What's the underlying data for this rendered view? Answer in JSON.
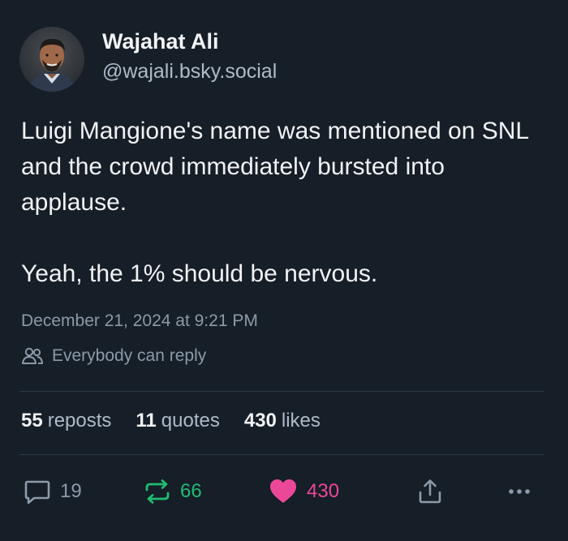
{
  "author": {
    "display_name": "Wajahat Ali",
    "handle": "@wajali.bsky.social",
    "avatar_icon": "avatar"
  },
  "post": {
    "paragraphs": [
      "Luigi Mangione's name was mentioned on SNL and the crowd immediately bursted into applause.",
      "Yeah, the 1% should be nervous."
    ],
    "timestamp": "December 21, 2024 at 9:21 PM",
    "reply_setting": "Everybody can reply"
  },
  "stats": {
    "reposts_count": "55",
    "reposts_label": "reposts",
    "quotes_count": "11",
    "quotes_label": "quotes",
    "likes_count": "430",
    "likes_label": "likes"
  },
  "actions": {
    "reply_count": "19",
    "repost_count": "66",
    "like_count": "430",
    "reply_icon": "speech-bubble-icon",
    "repost_icon": "repost-arrows-icon",
    "like_icon": "heart-icon",
    "share_icon": "share-icon",
    "more_icon": "more-dots-icon"
  },
  "colors": {
    "background": "#161e27",
    "text_primary": "#f1f3f5",
    "text_secondary": "#8c9aa9",
    "repost_active": "#20bc73",
    "like_active": "#ec4899"
  }
}
